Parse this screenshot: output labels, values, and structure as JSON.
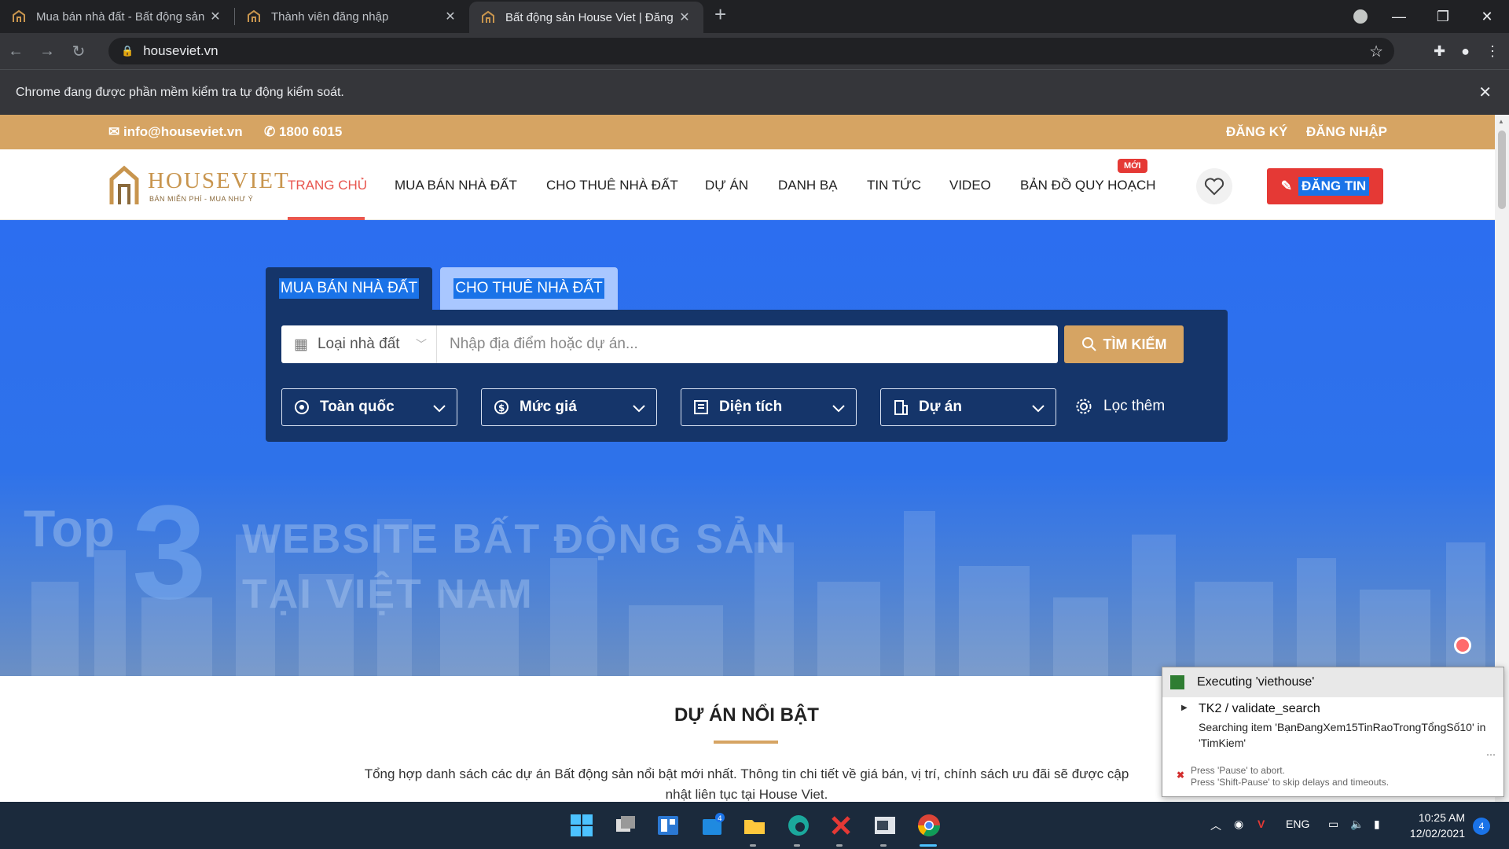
{
  "browser": {
    "tabs": [
      {
        "title": "Mua bán nhà đất - Bất động sản",
        "active": false
      },
      {
        "title": "Thành viên đăng nhập",
        "active": false
      },
      {
        "title": "Bất động sản House Viet | Đăng t",
        "active": true
      }
    ],
    "url": "houseviet.vn",
    "infobar": "Chrome đang được phần mềm kiểm tra tự động kiểm soát."
  },
  "topbar": {
    "email": "info@houseviet.vn",
    "phone": "1800 6015",
    "register": "ĐĂNG KÝ",
    "login": "ĐĂNG NHẬP"
  },
  "logo": {
    "name": "HOUSEVIET",
    "tagline": "BÁN MIỄN PHÍ - MUA NHƯ Ý"
  },
  "nav": {
    "items": [
      "TRANG CHỦ",
      "MUA BÁN NHÀ ĐẤT",
      "CHO THUÊ NHÀ ĐẤT",
      "DỰ ÁN",
      "DANH BẠ",
      "TIN TỨC",
      "VIDEO",
      "BẢN ĐỒ QUY HOẠCH"
    ],
    "new_badge": "MỚI",
    "post_button": "ĐĂNG TIN"
  },
  "search": {
    "tab_sell": "MUA BÁN NHÀ ĐẤT",
    "tab_rent": "CHO THUÊ NHÀ ĐẤT",
    "type_label": "Loại nhà đất",
    "placeholder": "Nhập địa điểm hoặc dự án...",
    "button": "TÌM KIẾM",
    "filters": [
      "Toàn quốc",
      "Mức giá",
      "Diện tích",
      "Dự án"
    ],
    "more": "Lọc thêm"
  },
  "banner": {
    "top": "Top",
    "number": "3",
    "line1": "WEBSITE BẤT ĐỘNG SẢN",
    "line2": "TẠI VIỆT NAM"
  },
  "featured": {
    "title": "DỰ ÁN NỔI BẬT",
    "description": "Tổng hợp danh sách các dự án Bất động sản nổi bật mới nhất. Thông tin chi tiết về giá bán, vị trí, chính sách ưu đãi sẽ được cập nhật liên tục tại House Viet."
  },
  "automation": {
    "header": "Executing 'viethouse'",
    "step": "TK2 / validate_search",
    "message_line1": "Searching item 'BạnĐangXem15TinRaoTrongTổngSố10' in",
    "message_line2": "'TimKiem'",
    "hint1": "Press 'Pause' to abort.",
    "hint2": "Press 'Shift-Pause' to skip delays and timeouts."
  },
  "taskbar": {
    "lang": "ENG",
    "time": "10:25 AM",
    "date": "12/02/2021",
    "notifications": "4",
    "store_badge": "4"
  },
  "colors": {
    "brand_gold": "#d6a463",
    "accent_red": "#e8564f",
    "hero_blue": "#2c6ef0",
    "panel_navy": "#15356a"
  }
}
